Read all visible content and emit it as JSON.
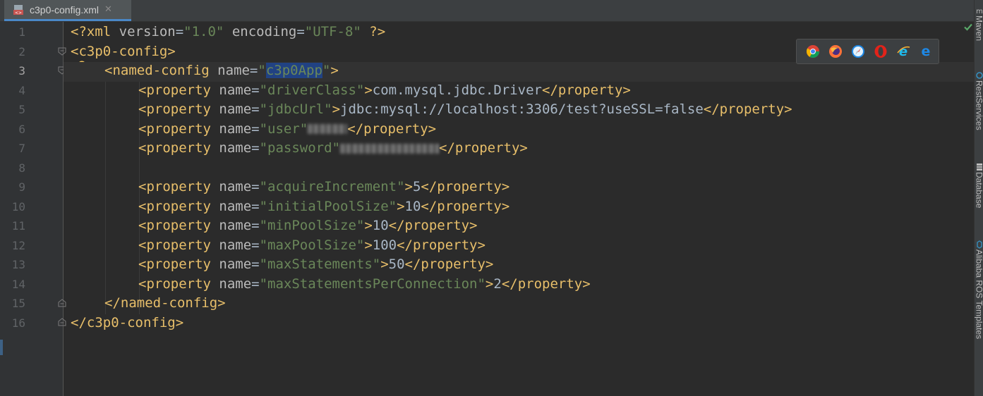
{
  "tab": {
    "file_name": "c3p0-config.xml",
    "close_symbol": "✕",
    "icon": "xml-file-icon"
  },
  "editor": {
    "line_numbers": [
      "1",
      "2",
      "3",
      "4",
      "5",
      "6",
      "7",
      "8",
      "9",
      "10",
      "11",
      "12",
      "13",
      "14",
      "15",
      "16"
    ],
    "current_line": "3",
    "lines": {
      "l1": {
        "open": "<?xml",
        "attr1": " version",
        "eq1": "=",
        "val1": "\"1.0\"",
        "attr2": " encoding",
        "eq2": "=",
        "val2": "\"UTF-8\"",
        "close": " ?>"
      },
      "l2": {
        "tag": "<c3p0-config>"
      },
      "l3": {
        "open": "<named-config",
        "attr": " name",
        "eq": "=",
        "q1": "\"",
        "selected": "c3p0App",
        "q2": "\"",
        "close": ">"
      },
      "l4": {
        "open": "<property",
        "attr": " name",
        "eq": "=",
        "val": "\"driverClass\"",
        "gt": ">",
        "text": "com.mysql.jdbc.Driver",
        "end": "</property>"
      },
      "l5": {
        "open": "<property",
        "attr": " name",
        "eq": "=",
        "val": "\"jdbcUrl\"",
        "gt": ">",
        "text": "jdbc:mysql://localhost:3306/test?useSSL=false",
        "end": "</property>"
      },
      "l6": {
        "open": "<property",
        "attr": " name",
        "eq": "=",
        "val": "\"user\"",
        "end": "</property>"
      },
      "l7": {
        "open": "<property",
        "attr": " name",
        "eq": "=",
        "val": "\"password\"",
        "end": "</property>"
      },
      "l9": {
        "open": "<property",
        "attr": " name",
        "eq": "=",
        "val": "\"acquireIncrement\"",
        "gt": ">",
        "text": "5",
        "end": "</property>"
      },
      "l10": {
        "open": "<property",
        "attr": " name",
        "eq": "=",
        "val": "\"initialPoolSize\"",
        "gt": ">",
        "text": "10",
        "end": "</property>"
      },
      "l11": {
        "open": "<property",
        "attr": " name",
        "eq": "=",
        "val": "\"minPoolSize\"",
        "gt": ">",
        "text": "10",
        "end": "</property>"
      },
      "l12": {
        "open": "<property",
        "attr": " name",
        "eq": "=",
        "val": "\"maxPoolSize\"",
        "gt": ">",
        "text": "100",
        "end": "</property>"
      },
      "l13": {
        "open": "<property",
        "attr": " name",
        "eq": "=",
        "val": "\"maxStatements\"",
        "gt": ">",
        "text": "50",
        "end": "</property>"
      },
      "l14": {
        "open": "<property",
        "attr": " name",
        "eq": "=",
        "val": "\"maxStatementsPerConnection\"",
        "gt": ">",
        "text": "2",
        "end": "</property>"
      },
      "l15": {
        "tag": "</named-config>"
      },
      "l16": {
        "tag": "</c3p0-config>"
      }
    }
  },
  "browser_bar": {
    "browsers": [
      "chrome-icon",
      "firefox-icon",
      "safari-icon",
      "opera-icon",
      "internet-explorer-icon",
      "edge-icon"
    ]
  },
  "right_strip": {
    "items": [
      "Maven",
      "RestServices",
      "Database",
      "Alibaba ROS Templates"
    ]
  },
  "colors": {
    "background": "#2b2b2b",
    "tag": "#e8bf6a",
    "attribute": "#bababa",
    "value": "#6a8759",
    "text": "#a9b7c6",
    "selection": "#214283",
    "gutter": "#313335",
    "line_number": "#606366"
  }
}
